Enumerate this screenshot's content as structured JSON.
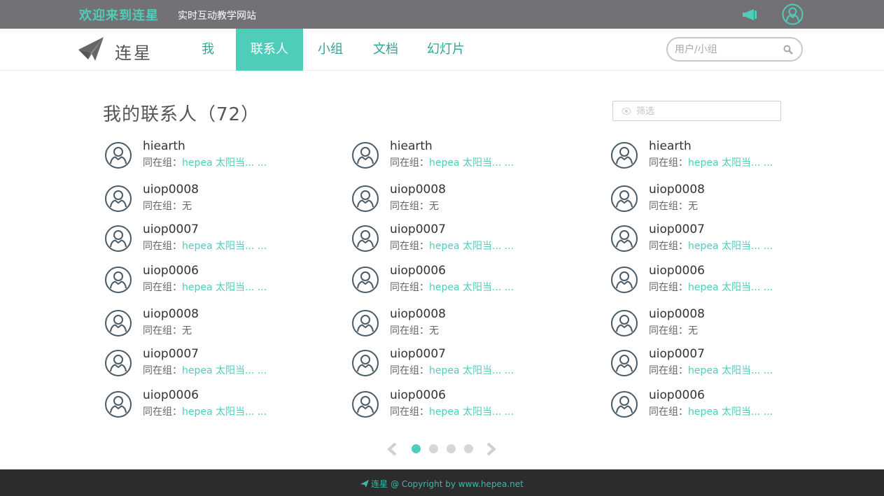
{
  "topbar": {
    "welcome": "欢迎来到连星",
    "tagline": "实时互动教学网站",
    "icons": [
      "megaphone-icon",
      "user-icon"
    ],
    "accent_color": "#4ecdb9",
    "bg_color": "#727175"
  },
  "navbar": {
    "logo_text": "连星",
    "items": [
      {
        "label": "我",
        "active": false
      },
      {
        "label": "联系人",
        "active": true
      },
      {
        "label": "小组",
        "active": false
      },
      {
        "label": "文档",
        "active": false
      },
      {
        "label": "幻灯片",
        "active": false
      }
    ],
    "search_placeholder": "用户/小组"
  },
  "main": {
    "title": "我的联系人（72）",
    "filter_placeholder": "筛选",
    "group_prefix": "同在组：",
    "contacts": [
      {
        "name": "hiearth",
        "group": "hepea 太阳当... ..."
      },
      {
        "name": "hiearth",
        "group": "hepea 太阳当... ..."
      },
      {
        "name": "hiearth",
        "group": "hepea 太阳当... ..."
      },
      {
        "name": "uiop0008",
        "group": "无"
      },
      {
        "name": "uiop0008",
        "group": "无"
      },
      {
        "name": "uiop0008",
        "group": "无"
      },
      {
        "name": "uiop0007",
        "group": "hepea 太阳当... ..."
      },
      {
        "name": "uiop0007",
        "group": "hepea 太阳当... ..."
      },
      {
        "name": "uiop0007",
        "group": "hepea 太阳当... ..."
      },
      {
        "name": "uiop0006",
        "group": "hepea 太阳当... ..."
      },
      {
        "name": "uiop0006",
        "group": "hepea 太阳当... ..."
      },
      {
        "name": "uiop0006",
        "group": "hepea 太阳当... ..."
      },
      {
        "name": "uiop0008",
        "group": "无"
      },
      {
        "name": "uiop0008",
        "group": "无"
      },
      {
        "name": "uiop0008",
        "group": "无"
      },
      {
        "name": "uiop0007",
        "group": "hepea 太阳当... ..."
      },
      {
        "name": "uiop0007",
        "group": "hepea 太阳当... ..."
      },
      {
        "name": "uiop0007",
        "group": "hepea 太阳当... ..."
      },
      {
        "name": "uiop0006",
        "group": "hepea 太阳当... ..."
      },
      {
        "name": "uiop0006",
        "group": "hepea 太阳当... ..."
      },
      {
        "name": "uiop0006",
        "group": "hepea 太阳当... ..."
      }
    ]
  },
  "pagination": {
    "pages": 4,
    "current": 1,
    "icons": [
      "chevron-left-icon",
      "chevron-right-icon"
    ]
  },
  "footer": {
    "brand": "连星",
    "copyright": " @ Copyright by www.hepea.net"
  }
}
